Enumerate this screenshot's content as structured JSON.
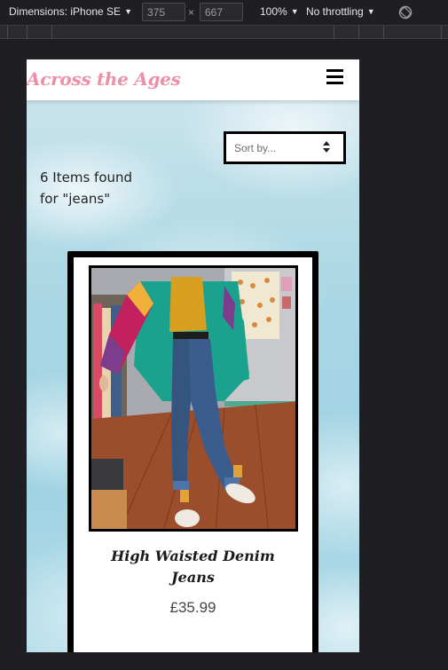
{
  "devtools": {
    "dimensions_label": "Dimensions: iPhone SE",
    "width_value": "375",
    "times": "×",
    "height_value": "667",
    "zoom": "100%",
    "throttling": "No throttling",
    "rotate_icon": "rotate-icon"
  },
  "site": {
    "brand": "Across the Ages",
    "menu_icon": "hamburger-menu-icon"
  },
  "sort": {
    "label": "Sort by...",
    "icon": "sort-arrows-icon"
  },
  "results": {
    "line1": "6 Items found",
    "line2": "for \"jeans\""
  },
  "products": [
    {
      "name": "High Waisted Denim Jeans",
      "price": "£35.99",
      "image_alt": "Person wearing colourful windbreaker jacket and high waisted denim jeans"
    }
  ],
  "colors": {
    "brand_pink": "#ee8fa8",
    "devtools_bg": "#1f1f23",
    "card_border": "#000000"
  }
}
